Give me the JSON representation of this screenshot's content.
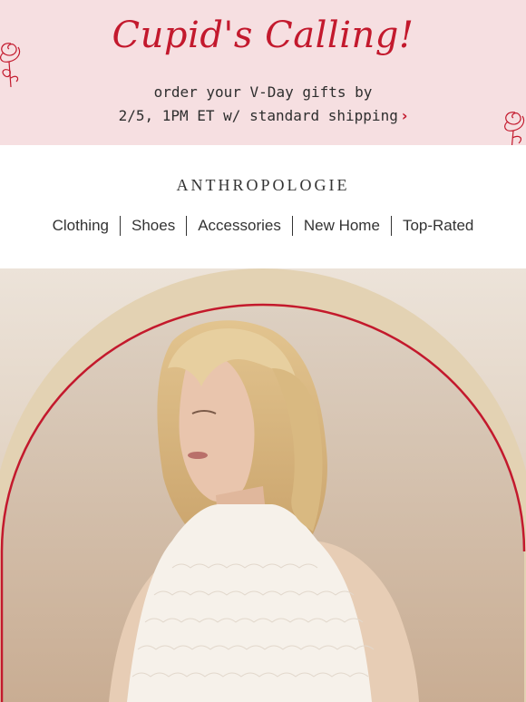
{
  "promo": {
    "title": "Cupid's Calling!",
    "line1": "order your V-Day gifts by",
    "line2": "2/5, 1PM ET w/ standard shipping",
    "chevron": "›",
    "accent_color": "#c3192d",
    "background": "#f6dfe1"
  },
  "brand": {
    "name": "ANTHROPOLOGIE"
  },
  "nav": {
    "items": [
      {
        "label": "Clothing"
      },
      {
        "label": "Shoes"
      },
      {
        "label": "Accessories"
      },
      {
        "label": "New Home"
      },
      {
        "label": "Top-Rated"
      }
    ]
  },
  "hero": {
    "arch_color": "#c3192d",
    "icons": [
      "rose-icon"
    ]
  }
}
